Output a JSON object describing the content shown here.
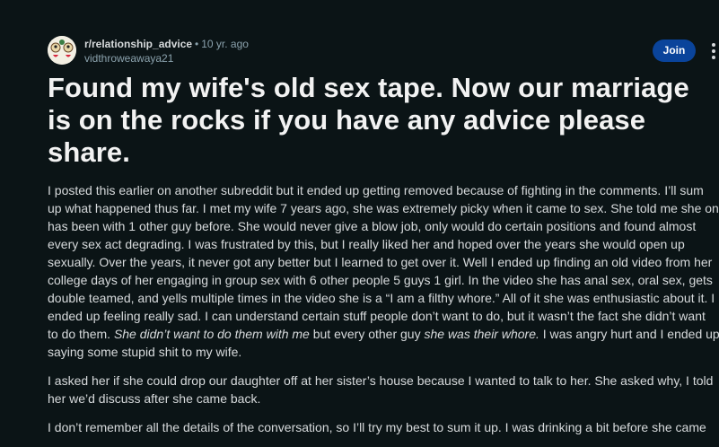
{
  "post": {
    "subreddit": "r/relationship_advice",
    "separator": "•",
    "age": "10 yr. ago",
    "username": "vidthroweawaya21",
    "join_label": "Join",
    "title": "Found my wife's old sex tape. Now our marriage is on the rocks if you have any advice please share."
  },
  "body": {
    "p1": {
      "l1": "I posted this earlier on another subreddit but it ended up getting removed because of fighting in the comments. I’ll sum",
      "l2": "up what happened thus far. I met my wife 7 years ago, she was extremely picky when it came to sex. She told me she only",
      "l3": "has been with 1 other guy before. She would never give a blow job, only would do certain positions and found almost",
      "l4": "every sex act degrading. I was frustrated by this, but I really liked her and hoped over the years she would open up",
      "l5": "sexually. Over the years, it never got any better but I learned to get over it. Well I ended up finding an old video from her",
      "l6": "college days of her engaging in group sex with 6 other people 5 guys 1 girl. In the video she has anal sex, oral sex, gets",
      "l7": "double teamed, and yells multiple times in the video she is a “I am a filthy whore.” All of it she was enthusiastic about it. I",
      "l8": "ended up feeling really sad. I can understand certain stuff people don’t want to do, but it wasn’t the fact she didn’t want",
      "l9_a": "to do them. ",
      "l9_b": "She didn’t want to do them with me",
      "l9_c": " but every other guy ",
      "l9_d": "she was their whore.",
      "l9_e": " I was angry hurt and I ended up",
      "l10": "saying some stupid shit to my wife."
    },
    "p2": {
      "l1": "I asked her if she could drop our daughter off at her sister’s house because I wanted to talk to her. She asked why, I told",
      "l2": "her we’d discuss after she came back."
    },
    "p3": {
      "l1": "I don’t remember all the details of the conversation, so I’ll try my best to sum it up. I was drinking a bit before she came"
    }
  },
  "icons": {
    "avatar": "subreddit-avatar-icon",
    "more": "more-options-icon"
  },
  "colors": {
    "background": "#0b1416",
    "join_button": "#0a449b",
    "text": "#d7dadc",
    "muted": "#8ba2ad"
  }
}
